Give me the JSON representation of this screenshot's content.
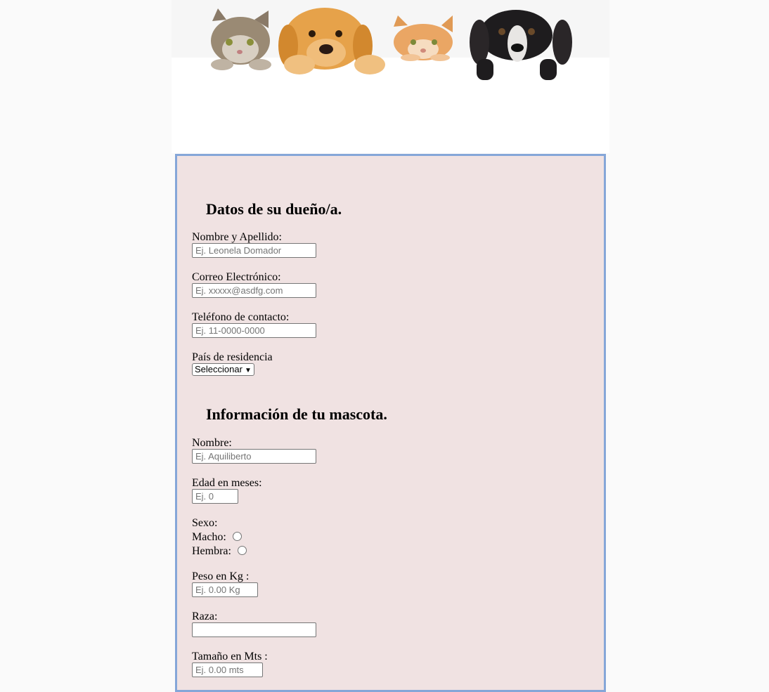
{
  "owner_section": {
    "title": "Datos de su dueño/a.",
    "name_label": "Nombre y Apellido:",
    "name_placeholder": "Ej. Leonela Domador",
    "email_label": "Correo Electrónico:",
    "email_placeholder": "Ej. xxxxx@asdfg.com",
    "phone_label": "Teléfono de contacto:",
    "phone_placeholder": "Ej. 11-0000-0000",
    "country_label": "País de residencia",
    "country_selected": "Seleccionar"
  },
  "pet_section": {
    "title": "Información de tu mascota.",
    "name_label": "Nombre:",
    "name_placeholder": "Ej. Aquiliberto",
    "age_label": "Edad en meses:",
    "age_placeholder": "Ej. 0",
    "sex_label": "Sexo:",
    "male_label": "Macho:",
    "female_label": "Hembra:",
    "weight_label": "Peso en Kg :",
    "weight_placeholder": "Ej. 0.00 Kg",
    "breed_label": "Raza:",
    "breed_placeholder": "",
    "size_label": "Tamaño en Mts :",
    "size_placeholder": "Ej. 0.00 mts"
  },
  "colors": {
    "form_background": "#f0e2e2",
    "form_border": "#85a6d8"
  }
}
